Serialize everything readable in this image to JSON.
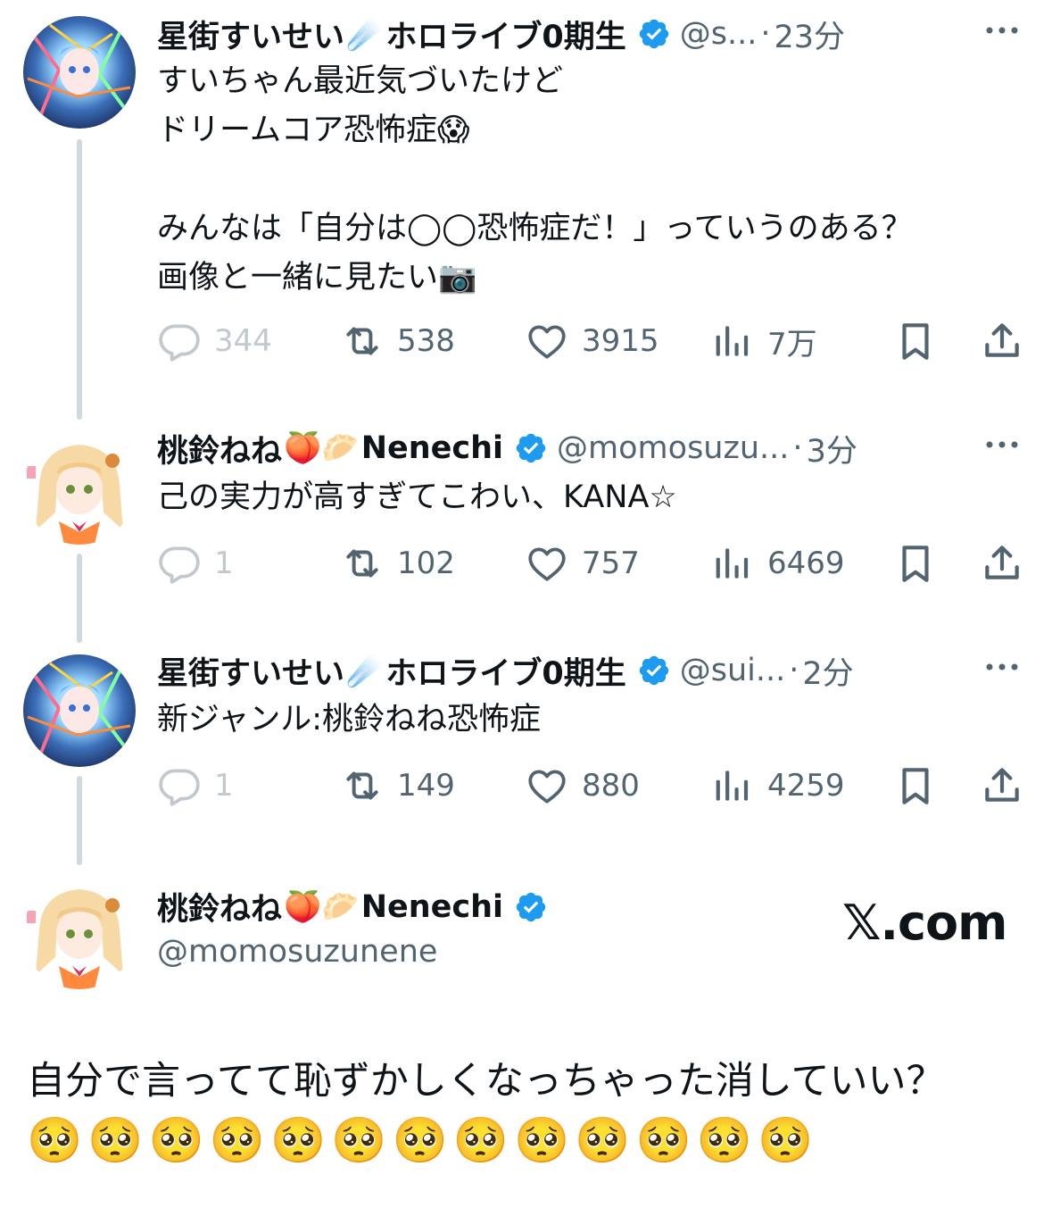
{
  "tweets": [
    {
      "name": "星街すいせい",
      "name_emoji": "☄️",
      "name_suffix": "ホロライブ0期生",
      "handle": "@s...",
      "time": "23分",
      "text": "すいちゃん最近気づいたけど\nドリームコア恐怖症😱\n\nみんなは「自分は◯◯恐怖症だ！」っていうのある？\n画像と一緒に見たい📷",
      "replies": "344",
      "retweets": "538",
      "likes": "3915",
      "views": "7万"
    },
    {
      "name": "桃鈴ねね",
      "name_emoji": "🍑🥟",
      "name_suffix": "Nenechi",
      "handle": "@momosuzu...",
      "time": "3分",
      "text": "己の実力が高すぎてこわい、KANA☆",
      "replies": "1",
      "retweets": "102",
      "likes": "757",
      "views": "6469"
    },
    {
      "name": "星街すいせい",
      "name_emoji": "☄️",
      "name_suffix": "ホロライブ0期生",
      "handle": "@sui...",
      "time": "2分",
      "text": "新ジャンル:桃鈴ねね恐怖症",
      "replies": "1",
      "retweets": "149",
      "likes": "880",
      "views": "4259"
    }
  ],
  "separator": "·",
  "final_post": {
    "name": "桃鈴ねね",
    "name_emoji": "🍑🥟",
    "name_suffix": "Nenechi",
    "handle": "@momosuzunene",
    "site": "𝕏.com",
    "text": "自分で言ってて恥ずかしくなっちゃった消していい？",
    "emojis": "🥺🥺🥺🥺🥺🥺🥺🥺🥺🥺🥺🥺🥺"
  },
  "colors": {
    "verified": "#1d9bf0",
    "secondary_text": "#536471",
    "thread_line": "#cfd9de"
  },
  "icons": [
    "reply-icon",
    "retweet-icon",
    "like-icon",
    "views-icon",
    "bookmark-icon",
    "share-icon",
    "verified-badge-icon",
    "more-icon"
  ]
}
